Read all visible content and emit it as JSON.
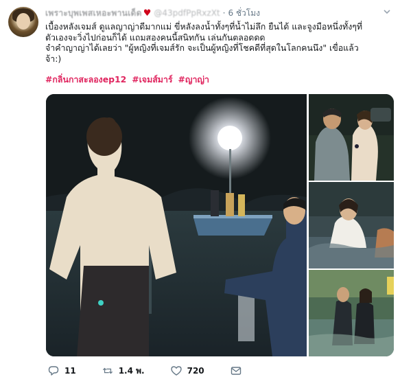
{
  "header": {
    "display_name": "เพราะบุพเพสเหอะพานเด็ด",
    "heart": "♥",
    "handle": "@43pdfPpRxzXt",
    "separator": "·",
    "time": "6 ชั่วโมง"
  },
  "tweet": {
    "lines": [
      "เบื้องหลังเจมส์ ดูแลญาญ่าดีมากแม่ ขี่หลังลงน้ำทั้งๆที่น้ำไม่ลึก ยืนได้ และจูงมือหนึ่งทั้งๆที่",
      "ตัวเองจะวิ่งไปก่อนก็ได้ แถมสองคนนี้สนิทกัน เล่นกันตลอดดด",
      "จำคำญาญ่าได้เลยว่า \"ผู้หญิงที่เจมส์รัก จะเป็นผู้หญิงที่โชคดีที่สุดในโลกคนนึง\" เขื่อแล้ว",
      "จ้า:)"
    ],
    "hashtags": [
      "#กลิ่นกาสะลองep12",
      "#เจมส์มาร์",
      "#ญาญ่า"
    ]
  },
  "media": {
    "count": 4
  },
  "actions": {
    "reply_count": "11",
    "retweet_count": "1.4 พ.",
    "like_count": "720"
  },
  "icons": {
    "reply": "reply-icon",
    "retweet": "retweet-icon",
    "like": "heart-icon",
    "dm": "envelope-icon",
    "more": "chevron-down-icon"
  },
  "colors": {
    "hashtag": "#e0245e",
    "muted": "#657786",
    "heart": "#d0021b"
  }
}
